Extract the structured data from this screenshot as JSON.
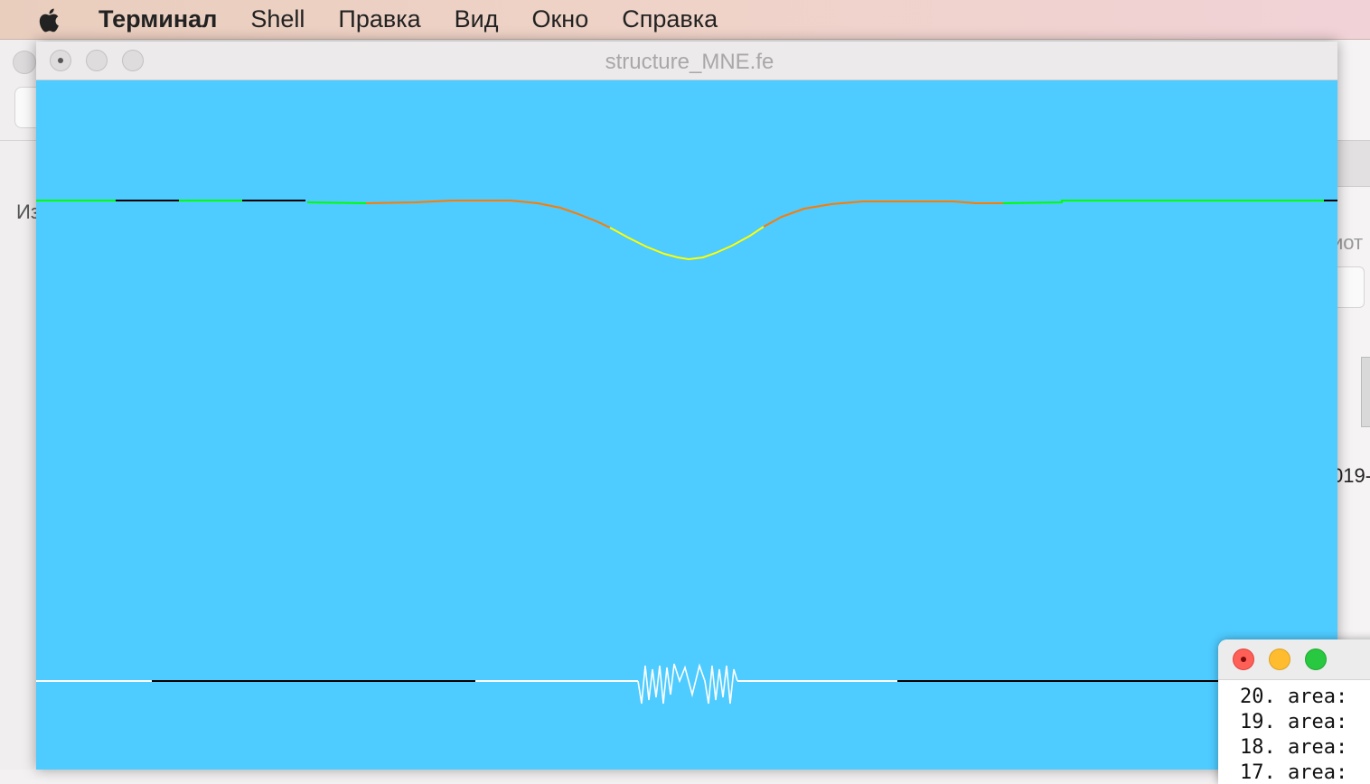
{
  "menubar": {
    "apple_icon": "apple-logo-icon",
    "items": [
      {
        "label": "Терминал",
        "bold": true
      },
      {
        "label": "Shell"
      },
      {
        "label": "Правка"
      },
      {
        "label": "Вид"
      },
      {
        "label": "Окно"
      },
      {
        "label": "Справка"
      }
    ]
  },
  "background_window": {
    "left_text_1": "Из",
    "right_text_1": "иот",
    "right_text_2": "019-"
  },
  "main_window": {
    "title": "structure_MNE.fe",
    "canvas_color": "#4ecbff"
  },
  "terminal": {
    "lines": [
      "20. area:",
      "19. area:",
      "18. area:",
      "17. area:"
    ]
  },
  "colors": {
    "upper_edge_green": "#00ff00",
    "upper_edge_orange": "#ff7a00",
    "upper_edge_yellow": "#ffff00",
    "edge_black": "#000000",
    "lower_edge_white": "#ffffff"
  }
}
